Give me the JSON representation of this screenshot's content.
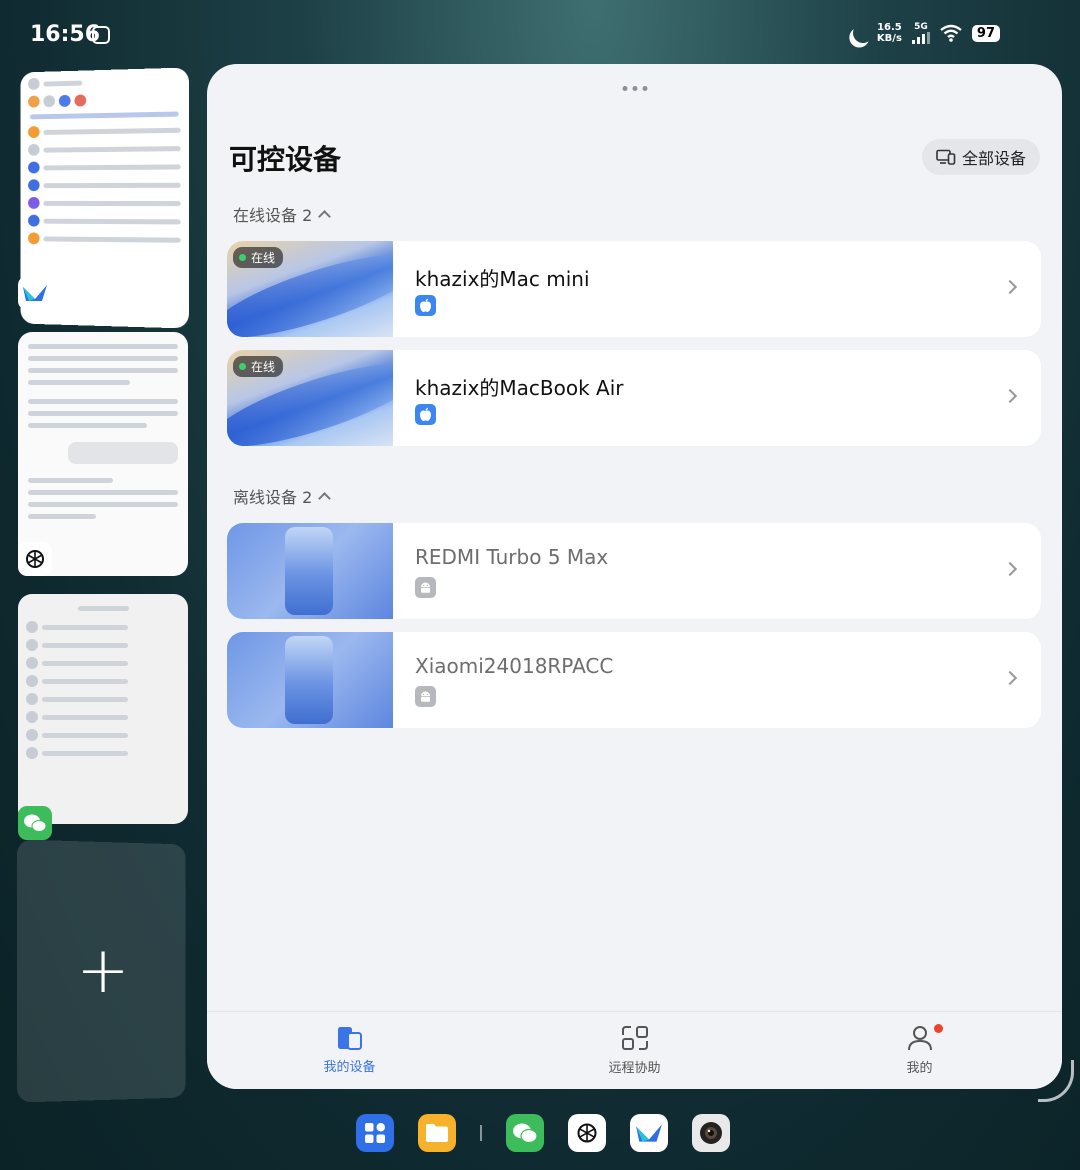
{
  "status_bar": {
    "time": "16:56",
    "speed_value": "16.5",
    "speed_unit": "KB/s",
    "network": "5G",
    "battery": "97"
  },
  "header": {
    "title": "可控设备",
    "all_devices_label": "全部设备"
  },
  "online_section": {
    "label": "在线设备 2",
    "devices": [
      {
        "name": "khazix的Mac mini",
        "tag": "在线"
      },
      {
        "name": "khazix的MacBook Air",
        "tag": "在线"
      }
    ]
  },
  "offline_section": {
    "label": "离线设备 2",
    "devices": [
      {
        "name": "REDMI Turbo 5 Max"
      },
      {
        "name": "Xiaomi24018RPACC"
      }
    ]
  },
  "bottom_nav": {
    "items": [
      {
        "label": "我的设备"
      },
      {
        "label": "远程协助"
      },
      {
        "label": "我的"
      }
    ]
  },
  "recents": {
    "add_symbol": "+"
  },
  "colors": {
    "accent": "#3a74e6",
    "online_dot": "#3cd16b",
    "notification_dot": "#e8452c",
    "apple_badge": "#3b86f0",
    "android_badge": "#b5b8bd"
  }
}
